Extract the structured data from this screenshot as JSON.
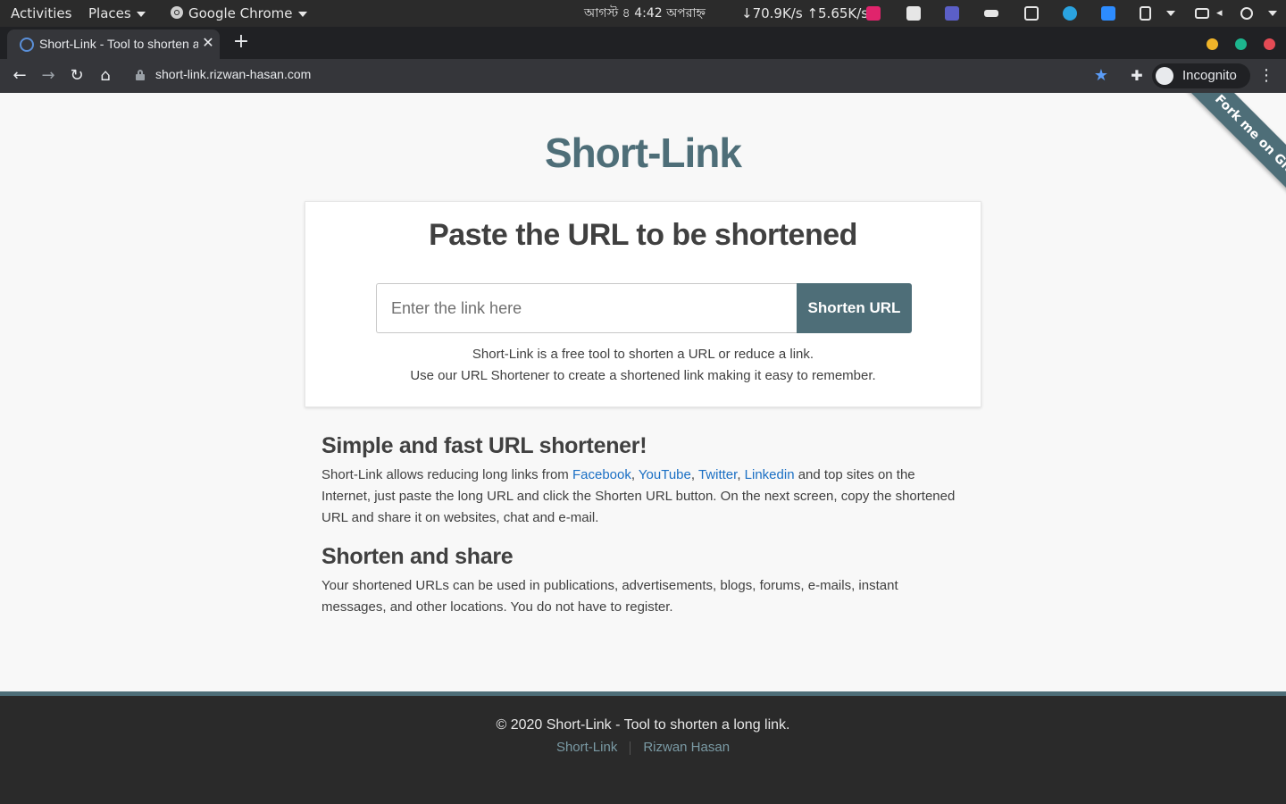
{
  "topbar": {
    "activities": "Activities",
    "places": "Places",
    "app": "Google Chrome",
    "clock": "আগস্ট ৪   4:42 অপরাহ্ন",
    "netspeed": "↓70.9K/s ↑5.65K/s"
  },
  "browser": {
    "tab_title": "Short-Link - Tool to shorten a long link",
    "url": "short-link.rizwan-hasan.com",
    "profile_label": "Incognito"
  },
  "page": {
    "ribbon": "Fork me on GitHub",
    "site_title": "Short-Link",
    "card_heading": "Paste the URL to be shortened",
    "input_placeholder": "Enter the link here",
    "button_label": "Shorten URL",
    "desc_line1": "Short-Link is a free tool to shorten a URL or reduce a link.",
    "desc_line2": "Use our URL Shortener to create a shortened link making it easy to remember.",
    "section1": {
      "heading": "Simple and fast URL shortener!",
      "text_before": "Short-Link allows reducing long links from ",
      "links": [
        "Facebook",
        "YouTube",
        "Twitter",
        "Linkedin"
      ],
      "sep1": ", ",
      "sep2": ", ",
      "sep3": ", ",
      "text_after": " and top sites on the Internet, just paste the long URL and click the Shorten URL button. On the next screen, copy the shortened URL and share it on websites, chat and e-mail."
    },
    "section2": {
      "heading": "Shorten and share",
      "text": "Your shortened URLs can be used in publications, advertisements, blogs, forums, e-mails, instant messages, and other locations. You do not have to register."
    },
    "footer": {
      "copyright": "© 2020 Short-Link - Tool to shorten a long link.",
      "link1": "Short-Link",
      "link2": "Rizwan Hasan"
    }
  },
  "colors": {
    "brand": "#4e6e78",
    "link": "#1a6fc4",
    "footer_bg": "#2a2a2a",
    "window_min": "#f0b429",
    "window_max": "#1db58e",
    "window_close": "#e44b55"
  },
  "icons": [
    "chrome-icon",
    "back-icon",
    "forward-icon",
    "reload-icon",
    "home-icon",
    "lock-icon",
    "star-icon",
    "extensions-icon",
    "incognito-icon",
    "menu-icon",
    "close-icon",
    "plus-icon"
  ]
}
